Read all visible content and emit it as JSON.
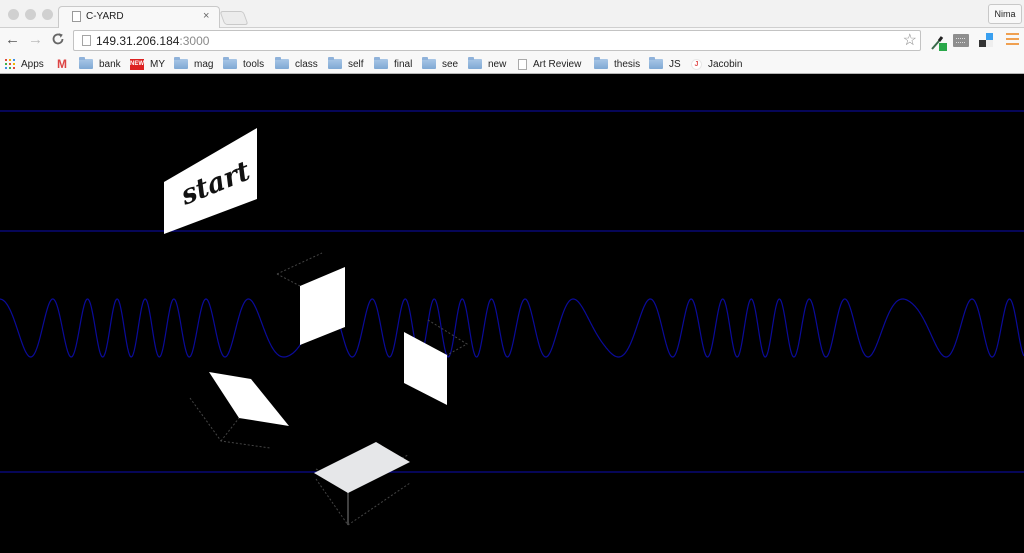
{
  "window": {
    "tab_title": "C-YARD",
    "tab_close": "×",
    "profile_name": "Nima"
  },
  "toolbar": {
    "back_icon": "←",
    "forward_icon": "→",
    "reload_icon": "C",
    "url_host": "149.31.206.184",
    "url_port": ":3000",
    "star_icon": "☆"
  },
  "bookmarks": [
    {
      "label": "Apps",
      "icon": "apps-grid"
    },
    {
      "label": "",
      "icon": "gmail"
    },
    {
      "label": "bank",
      "icon": "folder"
    },
    {
      "label": "MY",
      "icon": "new-badge"
    },
    {
      "label": "mag",
      "icon": "folder"
    },
    {
      "label": "tools",
      "icon": "folder"
    },
    {
      "label": "class",
      "icon": "folder"
    },
    {
      "label": "self",
      "icon": "folder"
    },
    {
      "label": "final",
      "icon": "folder"
    },
    {
      "label": "see",
      "icon": "folder"
    },
    {
      "label": "new",
      "icon": "folder"
    },
    {
      "label": "Art Review",
      "icon": "page"
    },
    {
      "label": "thesis",
      "icon": "folder"
    },
    {
      "label": "JS",
      "icon": "folder"
    },
    {
      "label": "Jacobin",
      "icon": "jacobin"
    }
  ],
  "icons": {
    "gmail_glyph": "M",
    "new_badge_text": "NEW",
    "jacobin_glyph": "J"
  },
  "scene": {
    "start_label": "start",
    "colors": {
      "background": "#000000",
      "line": "#0a0a8c",
      "wave": "#0b0b9a",
      "face": "#ffffff",
      "top_face": "#e6e7e9",
      "dotted_edge": "#444444"
    }
  }
}
